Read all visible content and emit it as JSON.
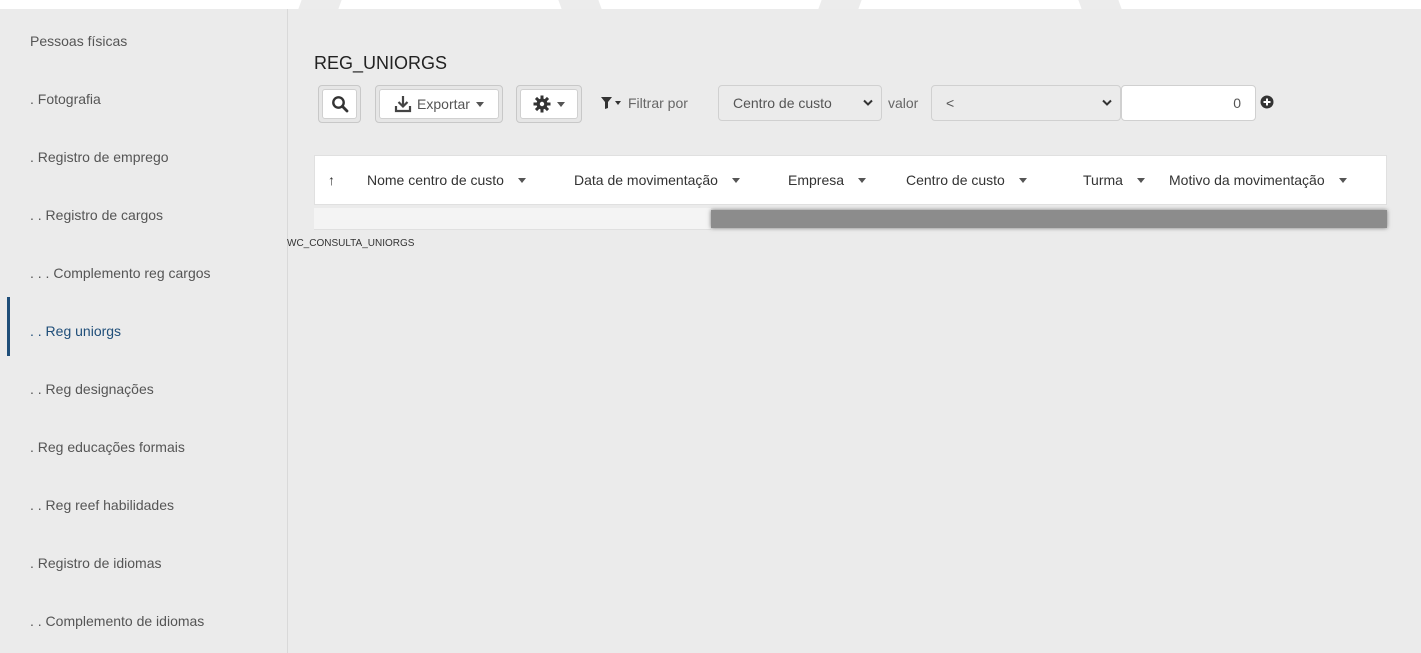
{
  "sidebar": {
    "items": [
      {
        "label": "Pessoas físicas",
        "active": false
      },
      {
        "label": ". Fotografia",
        "active": false
      },
      {
        "label": ". Registro de emprego",
        "active": false
      },
      {
        "label": ". . Registro de cargos",
        "active": false
      },
      {
        "label": ". . . Complemento reg cargos",
        "active": false
      },
      {
        "label": ". . Reg uniorgs",
        "active": true
      },
      {
        "label": ". . Reg designações",
        "active": false
      },
      {
        "label": ". Reg educações formais",
        "active": false
      },
      {
        "label": ". . Reg reef habilidades",
        "active": false
      },
      {
        "label": ". Registro de idiomas",
        "active": false
      },
      {
        "label": ". . Complemento de idiomas",
        "active": false
      }
    ]
  },
  "main": {
    "title": "REG_UNIORGS",
    "toolbar": {
      "search_icon": "search-icon",
      "export_label": "Exportar",
      "gear_icon": "gear-icon",
      "filter_label": "Filtrar por",
      "filter_field": "Centro de custo",
      "valor_label": "valor",
      "operator": "<",
      "value": "0"
    },
    "table": {
      "sort_indicator": "↑",
      "columns": [
        "Nome centro de custo",
        "Data de movimentação",
        "Empresa",
        "Centro de custo",
        "Turma",
        "Motivo da movimentação"
      ]
    },
    "footer_label": "WC_CONSULTA_UNIORGS"
  },
  "colors": {
    "accent": "#1f4e79",
    "background": "#ebebeb"
  }
}
